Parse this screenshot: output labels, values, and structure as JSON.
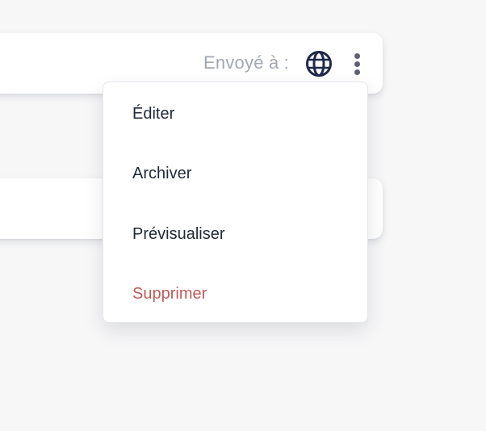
{
  "card": {
    "sent_to_label": "Envoyé à :",
    "globe_icon": "globe-icon",
    "more_icon": "kebab-menu-icon"
  },
  "menu": {
    "items": [
      {
        "label": "Éditer"
      },
      {
        "label": "Archiver"
      },
      {
        "label": "Prévisualiser"
      },
      {
        "label": "Supprimer",
        "color": "#c05a5a"
      }
    ]
  },
  "colors": {
    "background": "#f7f7f8",
    "text_primary": "#1f2937",
    "text_muted": "#a3a7b3",
    "danger": "#c05a5a",
    "icon_dark": "#1e2a4a"
  }
}
